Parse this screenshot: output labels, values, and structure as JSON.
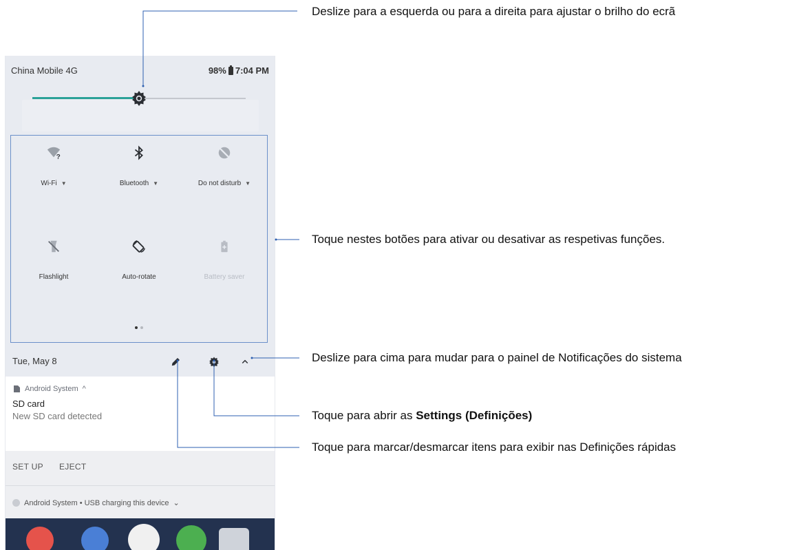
{
  "status_bar": {
    "carrier": "China Mobile 4G",
    "battery": "98%",
    "time": "7:04 PM"
  },
  "brightness": {
    "level": 0.5
  },
  "tiles": [
    {
      "label": "Wi-Fi",
      "icon": "wifi-unknown-icon",
      "has_menu": true
    },
    {
      "label": "Bluetooth",
      "icon": "bluetooth-icon",
      "has_menu": true
    },
    {
      "label": "Do not disturb",
      "icon": "do-not-disturb-icon",
      "has_menu": true
    },
    {
      "label": "Flashlight",
      "icon": "flashlight-off-icon",
      "has_menu": false
    },
    {
      "label": "Auto-rotate",
      "icon": "auto-rotate-icon",
      "has_menu": false
    },
    {
      "label": "Battery saver",
      "icon": "battery-saver-icon",
      "has_menu": false
    }
  ],
  "pager": {
    "page": 1,
    "pages": 2
  },
  "date_bar": {
    "date": "Tue, May 8"
  },
  "notification": {
    "app": "Android System",
    "title": "SD card",
    "text": "New SD card detected",
    "actions": [
      "SET UP",
      "EJECT"
    ]
  },
  "notification2": {
    "text": "Android System • USB charging this device"
  },
  "callouts": {
    "brightness": "Deslize para a esquerda ou para a direita para ajustar o brilho do ecrã",
    "tiles": "Toque nestes botões para ativar ou desativar as respetivas funções.",
    "collapse": "Deslize para cima para mudar para o painel de Notificações do sistema",
    "settings_prefix": "Toque para abrir as ",
    "settings_bold": "Settings (Definições)",
    "edit": "Toque para marcar/desmarcar itens para exibir nas Definições rápidas"
  },
  "colors": {
    "accent": "#2aa198",
    "panel": "#e8ebf1",
    "callout_line": "#2d5fb0"
  }
}
